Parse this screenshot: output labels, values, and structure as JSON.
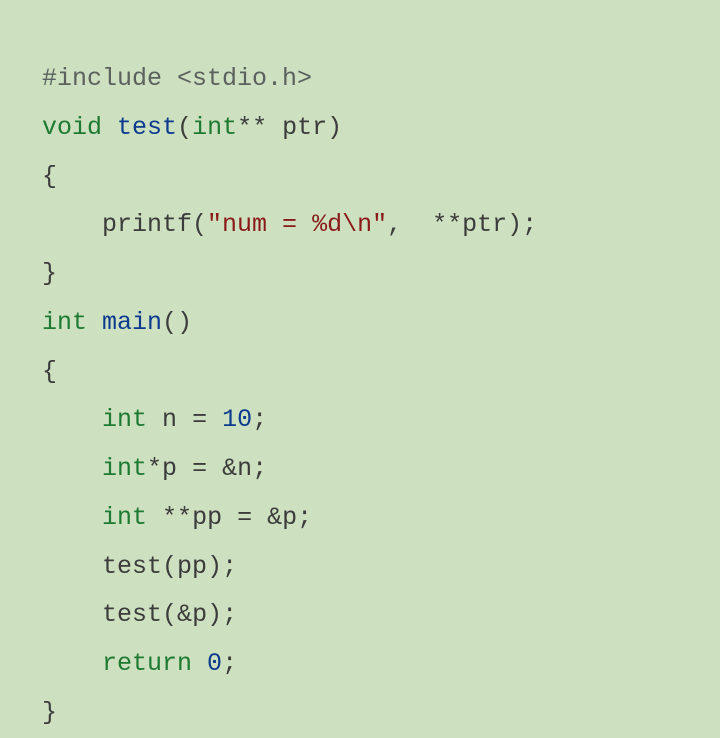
{
  "code": {
    "l1": {
      "include": "#include <stdio.h>"
    },
    "l2": {
      "kw_void": "void",
      "sp1": " ",
      "fn": "test",
      "lp": "(",
      "kw_int": "int",
      "stars": "**",
      "sp2": " ",
      "param": "ptr",
      "rp": ")"
    },
    "l3": {
      "brace": "{"
    },
    "l4": {
      "indent": "    ",
      "call": "printf",
      "lp": "(",
      "str": "\"num = %d\\n\"",
      "comma": ",",
      "sp": "  ",
      "stars": "**",
      "arg": "ptr",
      "rp": ")",
      "semi": ";"
    },
    "l5": {
      "brace": "}"
    },
    "l6": {
      "kw_int": "int",
      "sp": " ",
      "fn": "main",
      "lp": "(",
      "rp": ")"
    },
    "l7": {
      "brace": "{"
    },
    "l8": {
      "indent": "    ",
      "kw_int": "int",
      "sp1": " ",
      "id": "n",
      "sp2": " ",
      "eq": "=",
      "sp3": " ",
      "num": "10",
      "semi": ";"
    },
    "l9": {
      "indent": "    ",
      "kw_int": "int",
      "star": "*",
      "id": "p",
      "sp1": " ",
      "eq": "=",
      "sp2": " ",
      "amp": "&",
      "rhs": "n",
      "semi": ";"
    },
    "l10": {
      "indent": "    ",
      "kw_int": "int",
      "sp1": " ",
      "stars": "**",
      "id": "pp",
      "sp2": " ",
      "eq": "=",
      "sp3": " ",
      "amp": "&",
      "rhs": "p",
      "semi": ";"
    },
    "l11": {
      "indent": "    ",
      "call": "test",
      "lp": "(",
      "arg": "pp",
      "rp": ")",
      "semi": ";"
    },
    "l12": {
      "indent": "    ",
      "call": "test",
      "lp": "(",
      "amp": "&",
      "arg": "p",
      "rp": ")",
      "semi": ";"
    },
    "l13": {
      "indent": "    ",
      "kw_return": "return",
      "sp": " ",
      "num": "0",
      "semi": ";"
    },
    "l14": {
      "brace": "}"
    }
  }
}
